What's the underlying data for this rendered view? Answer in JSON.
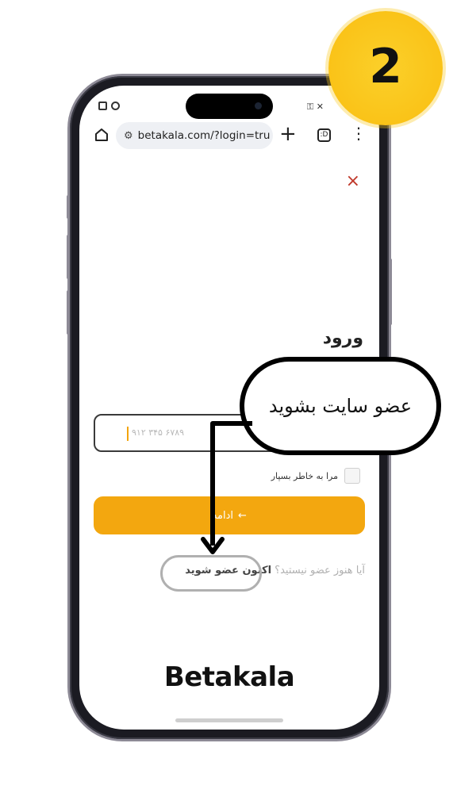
{
  "browser": {
    "url": "betakala.com/?login=tru",
    "tab_count": ":D",
    "status_right": "⚿ ✕"
  },
  "page": {
    "close_symbol": "×",
    "login_title": "ورود",
    "phone_placeholder": "۹۱۲ ۳۴۵ ۶۷۸۹",
    "remember_label": "مرا به خاطر بسپار",
    "continue_label": "ادامه",
    "continue_arrow": "←",
    "signup_question": "آیا هنوز عضو نیستید؟",
    "signup_link": "اکنون عضو شوید",
    "logo": "Betakala"
  },
  "overlay": {
    "step_number": "2",
    "callout_text": "عضو سایت بشوید"
  },
  "colors": {
    "accent": "#f3a70f",
    "close": "#c0392b",
    "badge": "#fac318"
  }
}
